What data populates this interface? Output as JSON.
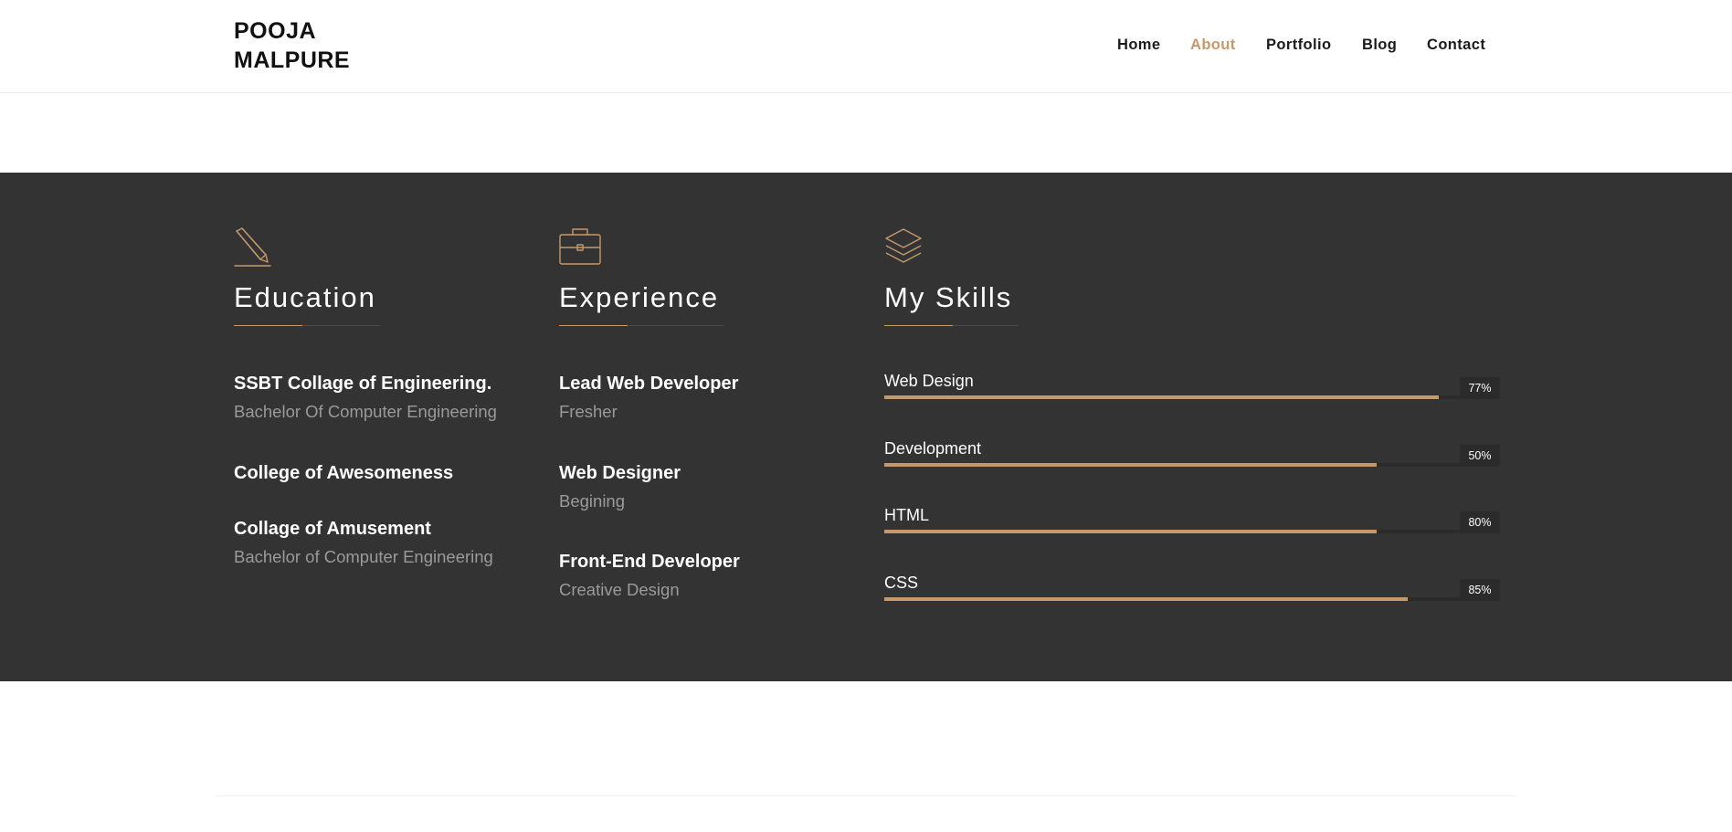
{
  "brand": {
    "line1": "POOJA",
    "line2": "MALPURE"
  },
  "nav": {
    "items": [
      {
        "label": "Home",
        "active": false
      },
      {
        "label": "About",
        "active": true
      },
      {
        "label": "Portfolio",
        "active": false
      },
      {
        "label": "Blog",
        "active": false
      },
      {
        "label": "Contact",
        "active": false
      }
    ]
  },
  "colors": {
    "accent": "#c49a6c",
    "section_bg": "#333333",
    "muted_text": "#9a9a9a"
  },
  "education": {
    "icon": "pencil-icon",
    "title": "Education",
    "items": [
      {
        "title": "SSBT Collage of Engineering.",
        "subtitle": "Bachelor Of Computer Engineering"
      },
      {
        "title": "College of Awesomeness",
        "subtitle": ""
      },
      {
        "title": "Collage of Amusement",
        "subtitle": "Bachelor of Computer Engineering"
      }
    ]
  },
  "experience": {
    "icon": "briefcase-icon",
    "title": "Experience",
    "items": [
      {
        "title": "Lead Web Developer",
        "subtitle": "Fresher"
      },
      {
        "title": "Web Designer",
        "subtitle": "Begining"
      },
      {
        "title": "Front-End Developer",
        "subtitle": "Creative Design"
      }
    ]
  },
  "skills": {
    "icon": "layers-icon",
    "title": "My Skills",
    "items": [
      {
        "label": "Web Design",
        "percent_label": "77%",
        "bar_fill": 0.9
      },
      {
        "label": "Development",
        "percent_label": "50%",
        "bar_fill": 0.8
      },
      {
        "label": "HTML",
        "percent_label": "80%",
        "bar_fill": 0.8
      },
      {
        "label": "CSS",
        "percent_label": "85%",
        "bar_fill": 0.85
      }
    ]
  }
}
